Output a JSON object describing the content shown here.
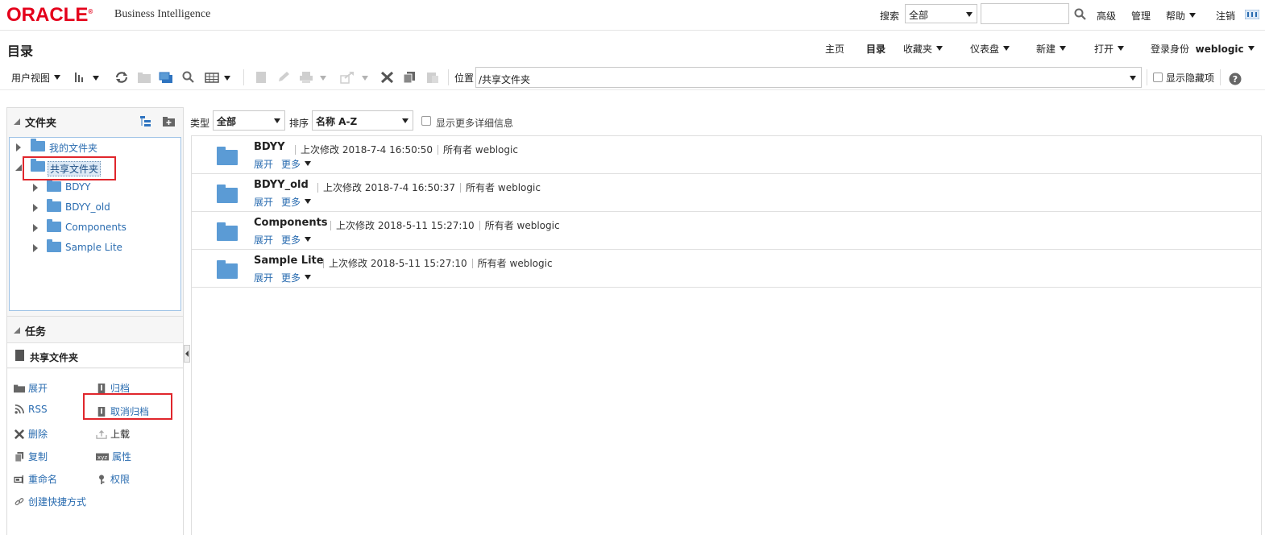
{
  "header": {
    "logo_oracle": "ORACLE",
    "logo_reg": "®",
    "logo_product": "Business Intelligence",
    "search_label": "搜索",
    "search_scope": "全部",
    "search_value": "",
    "advanced": "高级",
    "admin": "管理",
    "help": "帮助",
    "logout": "注销"
  },
  "titlebar": {
    "title": "目录",
    "nav": [
      "主页",
      "目录",
      "收藏夹",
      "仪表盘",
      "新建",
      "打开"
    ],
    "login_label": "登录身份",
    "username": "weblogic"
  },
  "toolbar": {
    "view": "用户视图",
    "location_label": "位置",
    "location_value": "/共享文件夹",
    "show_hidden": "显示隐藏项"
  },
  "folders_panel": {
    "title": "文件夹",
    "tree": [
      {
        "label": "我的文件夹"
      },
      {
        "label": "共享文件夹"
      },
      {
        "label": "BDYY"
      },
      {
        "label": "BDYY_old"
      },
      {
        "label": "Components"
      },
      {
        "label": "Sample Lite"
      }
    ]
  },
  "tasks_panel": {
    "title": "任务",
    "context": "共享文件夹",
    "tasks": [
      "展开",
      "归档",
      "RSS",
      "取消归档",
      "删除",
      "上载",
      "复制",
      "属性",
      "重命名",
      "权限",
      "创建快捷方式"
    ]
  },
  "filter": {
    "type_label": "类型",
    "type_value": "全部",
    "sort_label": "排序",
    "sort_value": "名称 A-Z",
    "more_details": "显示更多详细信息"
  },
  "items": [
    {
      "name": "BDYY",
      "modified_label": "上次修改",
      "modified": "2018-7-4 16:50:50",
      "owner_label": "所有者",
      "owner": "weblogic",
      "expand": "展开",
      "more": "更多"
    },
    {
      "name": "BDYY_old",
      "modified_label": "上次修改",
      "modified": "2018-7-4 16:50:37",
      "owner_label": "所有者",
      "owner": "weblogic",
      "expand": "展开",
      "more": "更多"
    },
    {
      "name": "Components",
      "modified_label": "上次修改",
      "modified": "2018-5-11 15:27:10",
      "owner_label": "所有者",
      "owner": "weblogic",
      "expand": "展开",
      "more": "更多"
    },
    {
      "name": "Sample Lite",
      "modified_label": "上次修改",
      "modified": "2018-5-11 15:27:10",
      "owner_label": "所有者",
      "owner": "weblogic",
      "expand": "展开",
      "more": "更多"
    }
  ],
  "colors": {
    "oracle_red": "#e4001b",
    "link_blue": "#2a6cb0",
    "folder_blue": "#5b9bd5",
    "highlight_red": "#e0262c"
  }
}
